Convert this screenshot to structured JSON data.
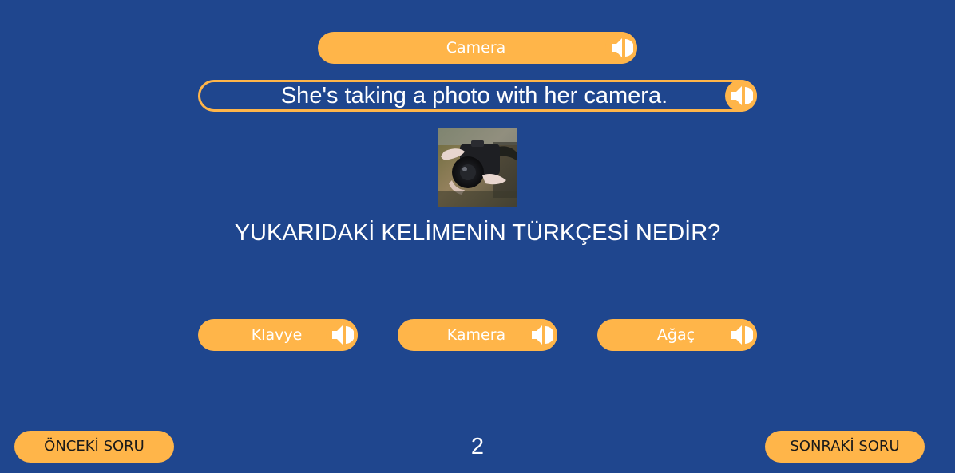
{
  "word_card": {
    "label": "Camera",
    "speaker_icon": "speaker-icon"
  },
  "sentence_card": {
    "text": "She's taking a photo with her camera.",
    "speaker_icon": "speaker-icon"
  },
  "image": {
    "subject": "hands holding a camera"
  },
  "question": {
    "text": "YUKARIDAKİ KELİMENİN TÜRKÇESİ NEDİR?"
  },
  "options": [
    {
      "label": "Klavye",
      "speaker_icon": "speaker-icon"
    },
    {
      "label": "Kamera",
      "speaker_icon": "speaker-icon"
    },
    {
      "label": "Ağaç",
      "speaker_icon": "speaker-icon"
    }
  ],
  "navigation": {
    "prev_label": "ÖNCEKİ SORU",
    "next_label": "SONRAKİ SORU",
    "page_number": "2"
  },
  "colors": {
    "background": "#1f468e",
    "accent": "#ffb549",
    "text": "#ffffff",
    "nav_text": "#1a1a1a"
  }
}
